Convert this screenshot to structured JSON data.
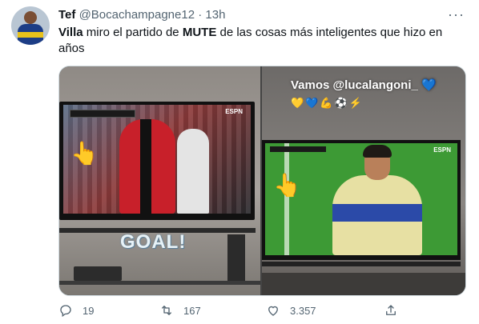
{
  "tweet": {
    "author_name": "Tef",
    "handle": "@Bocachampagne12",
    "separator": "·",
    "time": "13h",
    "more_label": "···",
    "text_prefix": "Villa",
    "text_mid": " miro el partido de ",
    "text_bold": "MUTE",
    "text_suffix": " de las cosas más inteligentes que hizo en años"
  },
  "media": {
    "left_caption": "GOAL!",
    "left_hand_emoji": "👆",
    "right_caption": "Vamos @lucalangoni_ 💙",
    "right_emojis": "💛💙💪⚽⚡",
    "right_hand_emoji": "👆",
    "espn_left": "ESPN",
    "espn_right": "ESPN"
  },
  "actions": {
    "reply_count": "19",
    "retweet_count": "167",
    "like_count": "3.357"
  },
  "colors": {
    "text": "#0f1419",
    "secondary": "#536471",
    "border": "#cfd9de"
  },
  "icons": [
    "reply-icon",
    "retweet-icon",
    "like-icon",
    "share-icon",
    "more-icon"
  ]
}
